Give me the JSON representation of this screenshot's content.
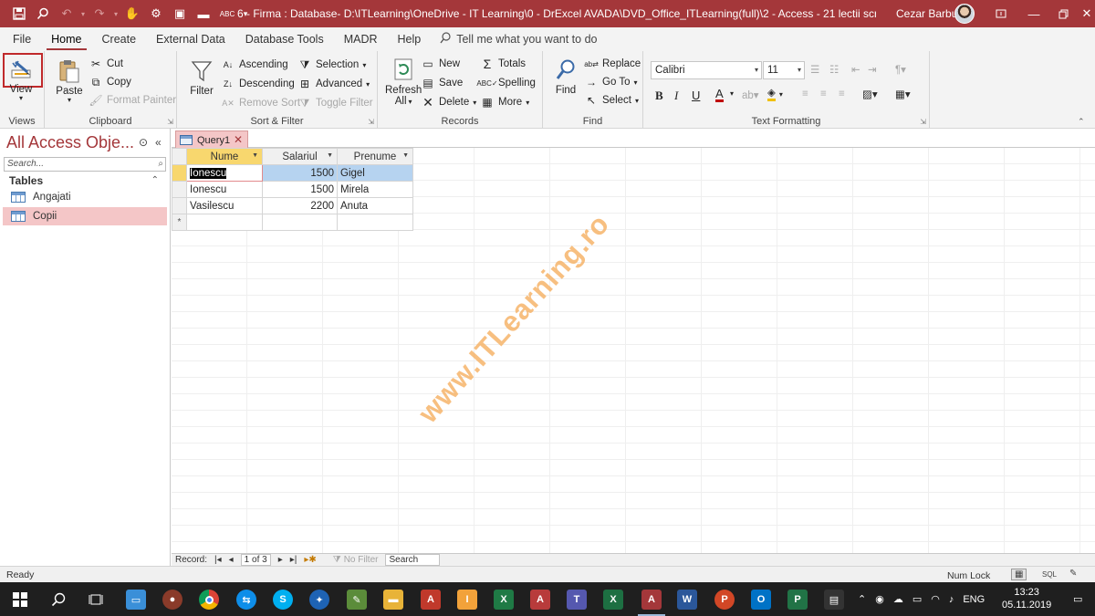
{
  "window": {
    "title": "6 - Firma : Database- D:\\ITLearning\\OneDrive - IT Learning\\0 - DrExcel AVADA\\DVD_Office_ITLearning(full)\\2 - Access - 21 lectii scrise\\1 - Access\\6 (...",
    "user": "Cezar Barbu"
  },
  "menu": {
    "tabs": [
      "File",
      "Home",
      "Create",
      "External Data",
      "Database Tools",
      "MADR",
      "Help"
    ],
    "active": "Home",
    "tell_me": "Tell me what you want to do"
  },
  "ribbon": {
    "views": {
      "view": "View",
      "label": "Views"
    },
    "clipboard": {
      "paste": "Paste",
      "cut": "Cut",
      "copy": "Copy",
      "format_painter": "Format Painter",
      "label": "Clipboard"
    },
    "sort_filter": {
      "filter": "Filter",
      "ascending": "Ascending",
      "descending": "Descending",
      "remove_sort": "Remove Sort",
      "selection": "Selection",
      "advanced": "Advanced",
      "toggle_filter": "Toggle Filter",
      "label": "Sort & Filter"
    },
    "records": {
      "refresh": "Refresh",
      "refresh_all": "All",
      "new": "New",
      "save": "Save",
      "delete": "Delete",
      "totals": "Totals",
      "spelling": "Spelling",
      "more": "More",
      "label": "Records"
    },
    "find": {
      "find": "Find",
      "replace": "Replace",
      "go_to": "Go To",
      "select": "Select",
      "label": "Find"
    },
    "text_formatting": {
      "font": "Calibri",
      "size": "11",
      "bold": "B",
      "italic": "I",
      "underline": "U",
      "font_color": "A",
      "label": "Text Formatting"
    }
  },
  "nav": {
    "title": "All Access Obje...",
    "search_placeholder": "Search...",
    "section": "Tables",
    "items": [
      {
        "label": "Angajati",
        "selected": false
      },
      {
        "label": "Copii",
        "selected": true
      }
    ]
  },
  "doc_tab": {
    "label": "Query1"
  },
  "datasheet": {
    "columns": [
      "Nume",
      "Salariul",
      "Prenume"
    ],
    "rows": [
      {
        "nume": "Ionescu",
        "salariul": "1500",
        "prenume": "Gigel"
      },
      {
        "nume": "Ionescu",
        "salariul": "1500",
        "prenume": "Mirela"
      },
      {
        "nume": "Vasilescu",
        "salariul": "2200",
        "prenume": "Anuta"
      }
    ],
    "new_row_marker": "*"
  },
  "record_nav": {
    "label": "Record:",
    "position": "1 of 3",
    "filter": "No Filter",
    "search": "Search"
  },
  "status": {
    "left": "Ready",
    "num_lock": "Num Lock",
    "sql": "SQL"
  },
  "watermark": "www.ITLearning.ro",
  "taskbar": {
    "language": "ENG",
    "time": "13:23",
    "date": "05.11.2019"
  },
  "colors": {
    "accent": "#a4373a",
    "selected_row": "#b6d3f0",
    "header_highlight": "#f8d76e",
    "nav_selected": "#f4c6c7"
  }
}
